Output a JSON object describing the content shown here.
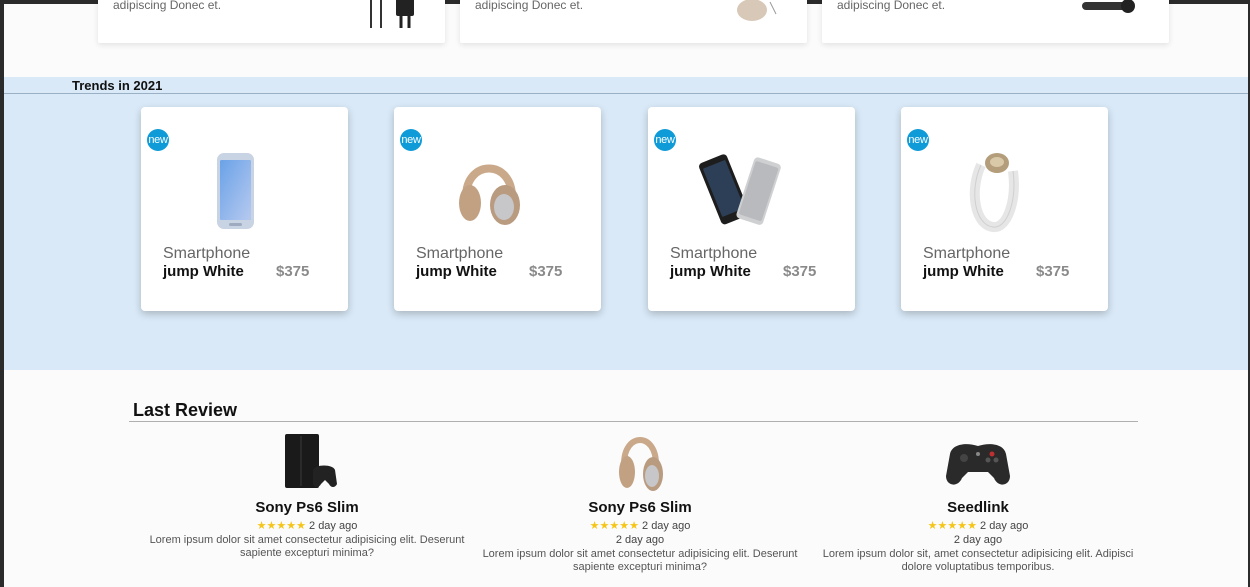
{
  "top_cards": [
    {
      "text": "adipiscing Donec et."
    },
    {
      "text": "adipiscing Donec et."
    },
    {
      "text": "adipiscing Donec et."
    }
  ],
  "trends": {
    "title": "Trends in 2021",
    "products": [
      {
        "badge": "new",
        "name": "Smartphone",
        "model": "jump White",
        "price": "$375",
        "image": "smartphone"
      },
      {
        "badge": "new",
        "name": "Smartphone",
        "model": "jump White",
        "price": "$375",
        "image": "headphones"
      },
      {
        "badge": "new",
        "name": "Smartphone",
        "model": "jump White",
        "price": "$375",
        "image": "smartphones-pair"
      },
      {
        "badge": "new",
        "name": "Smartphone",
        "model": "jump White",
        "price": "$375",
        "image": "fitness-band"
      }
    ]
  },
  "review": {
    "title": "Last Review",
    "items": [
      {
        "name": "Sony Ps6 Slim",
        "stars": "★★★★★",
        "date": "2 day ago",
        "date2": "",
        "text": "Lorem ipsum dolor sit amet consectetur adipisicing elit. Deserunt sapiente excepturi minima?",
        "image": "console"
      },
      {
        "name": "Sony Ps6 Slim",
        "stars": "★★★★★",
        "date": "2 day ago",
        "date2": "2 day ago",
        "text": "Lorem ipsum dolor sit amet consectetur adipisicing elit. Deserunt sapiente excepturi minima?",
        "image": "headphones"
      },
      {
        "name": "Seedlink",
        "stars": "★★★★★",
        "date": "2 day ago",
        "date2": "2 day ago",
        "text": "Lorem ipsum dolor sit, amet consectetur adipisicing elit. Adipisci dolore voluptatibus temporibus.",
        "image": "gamepad"
      }
    ]
  },
  "colors": {
    "trends_bg": "#d9e9f7",
    "badge": "#0e9bd8",
    "star": "#f5c518"
  }
}
